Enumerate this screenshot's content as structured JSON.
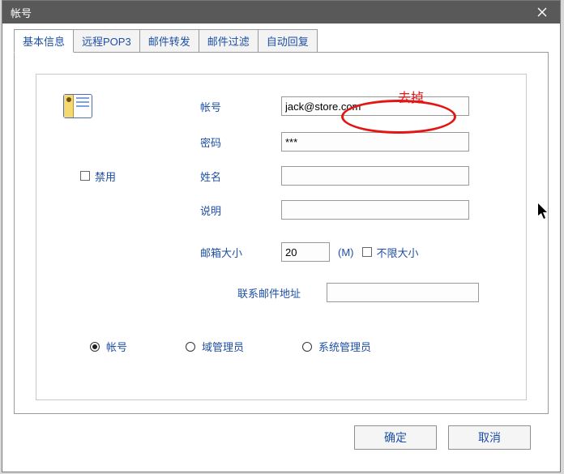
{
  "window": {
    "title": "帐号"
  },
  "tabs": [
    {
      "label": "基本信息",
      "active": true
    },
    {
      "label": "远程POP3",
      "active": false
    },
    {
      "label": "邮件转发",
      "active": false
    },
    {
      "label": "邮件过滤",
      "active": false
    },
    {
      "label": "自动回复",
      "active": false
    }
  ],
  "form": {
    "labels": {
      "account": "帐号",
      "password": "密码",
      "name": "姓名",
      "desc": "说明",
      "mailbox_size": "邮箱大小",
      "contact_email": "联系邮件地址",
      "disable": "禁用",
      "size_unit": "(M)",
      "unlimited_size": "不限大小"
    },
    "values": {
      "account": "jack@store.com",
      "password": "***",
      "name": "",
      "desc": "",
      "mailbox_size": "20",
      "contact_email": ""
    }
  },
  "roles": {
    "account": "帐号",
    "domain_admin": "域管理员",
    "system_admin": "系统管理员"
  },
  "buttons": {
    "ok": "确定",
    "cancel": "取消"
  },
  "annotation": {
    "remove_text": "去掉"
  }
}
